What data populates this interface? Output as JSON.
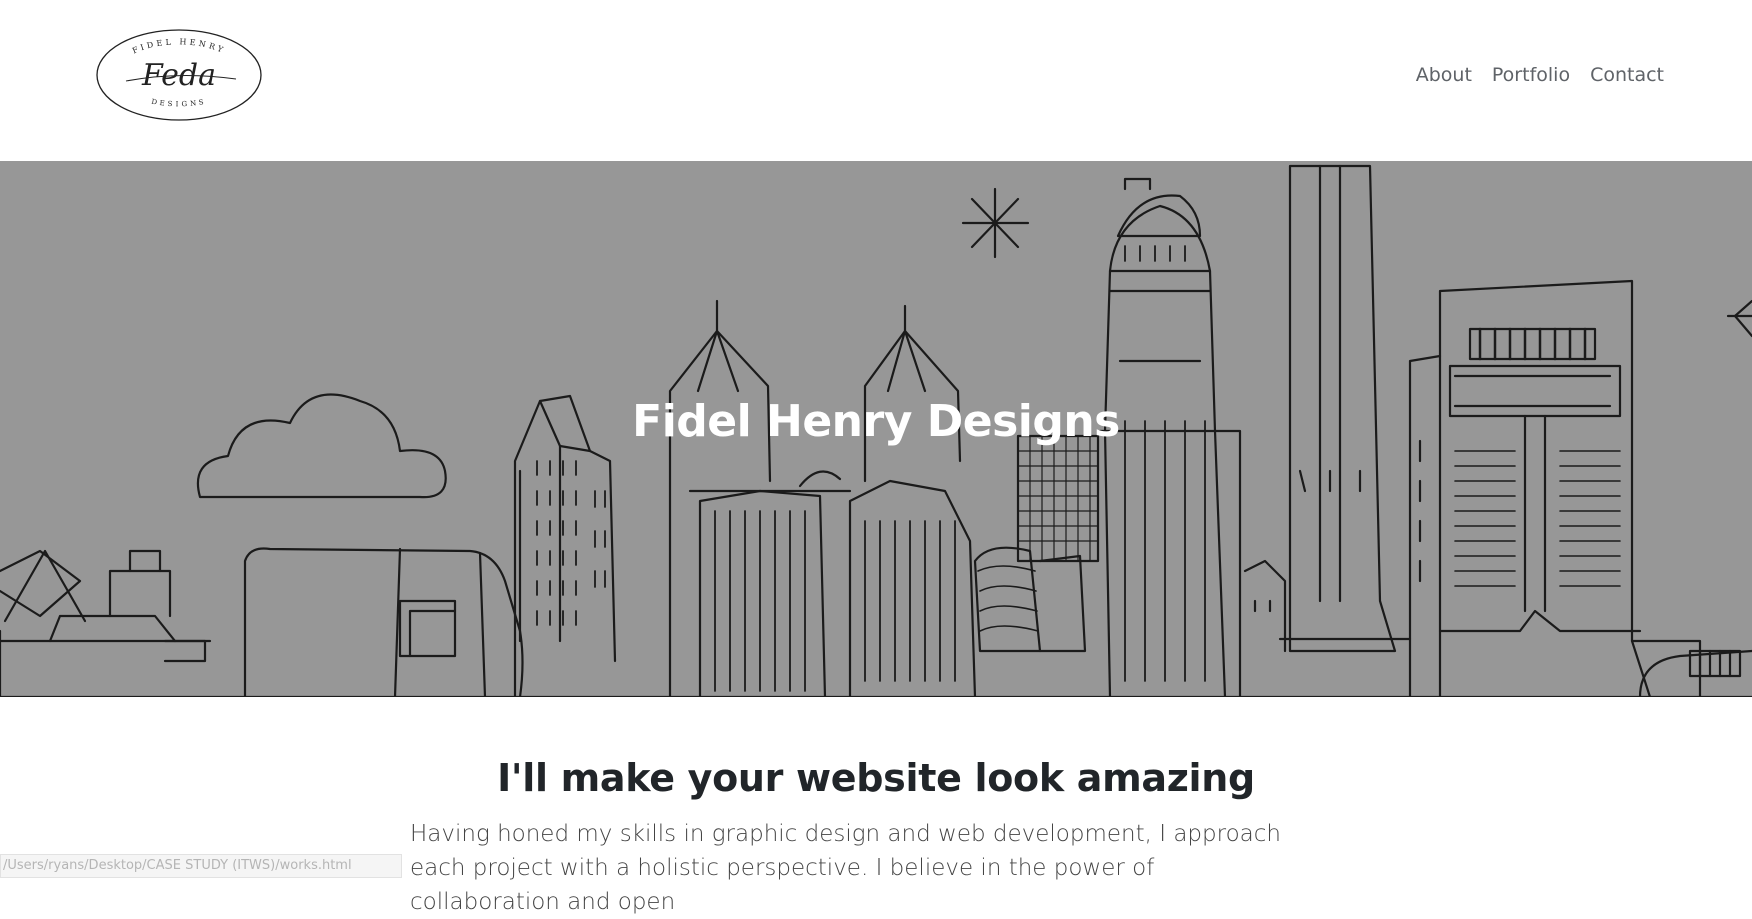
{
  "brand": {
    "logo_top_text": "FIDEL HENRY",
    "logo_script": "Feda",
    "logo_bottom_text": "DESIGNS"
  },
  "nav": {
    "items": [
      {
        "label": "About"
      },
      {
        "label": "Portfolio"
      },
      {
        "label": "Contact"
      }
    ]
  },
  "hero": {
    "title": "Fidel Henry Designs",
    "background": "#979797"
  },
  "about": {
    "heading": "I'll make your website look amazing",
    "text": "Having honed my skills in graphic design and web development, I approach each project with a holistic perspective. I believe in the power of collaboration and open"
  },
  "statusbar": {
    "url": "/Users/ryans/Desktop/CASE STUDY (ITWS)/works.html"
  }
}
